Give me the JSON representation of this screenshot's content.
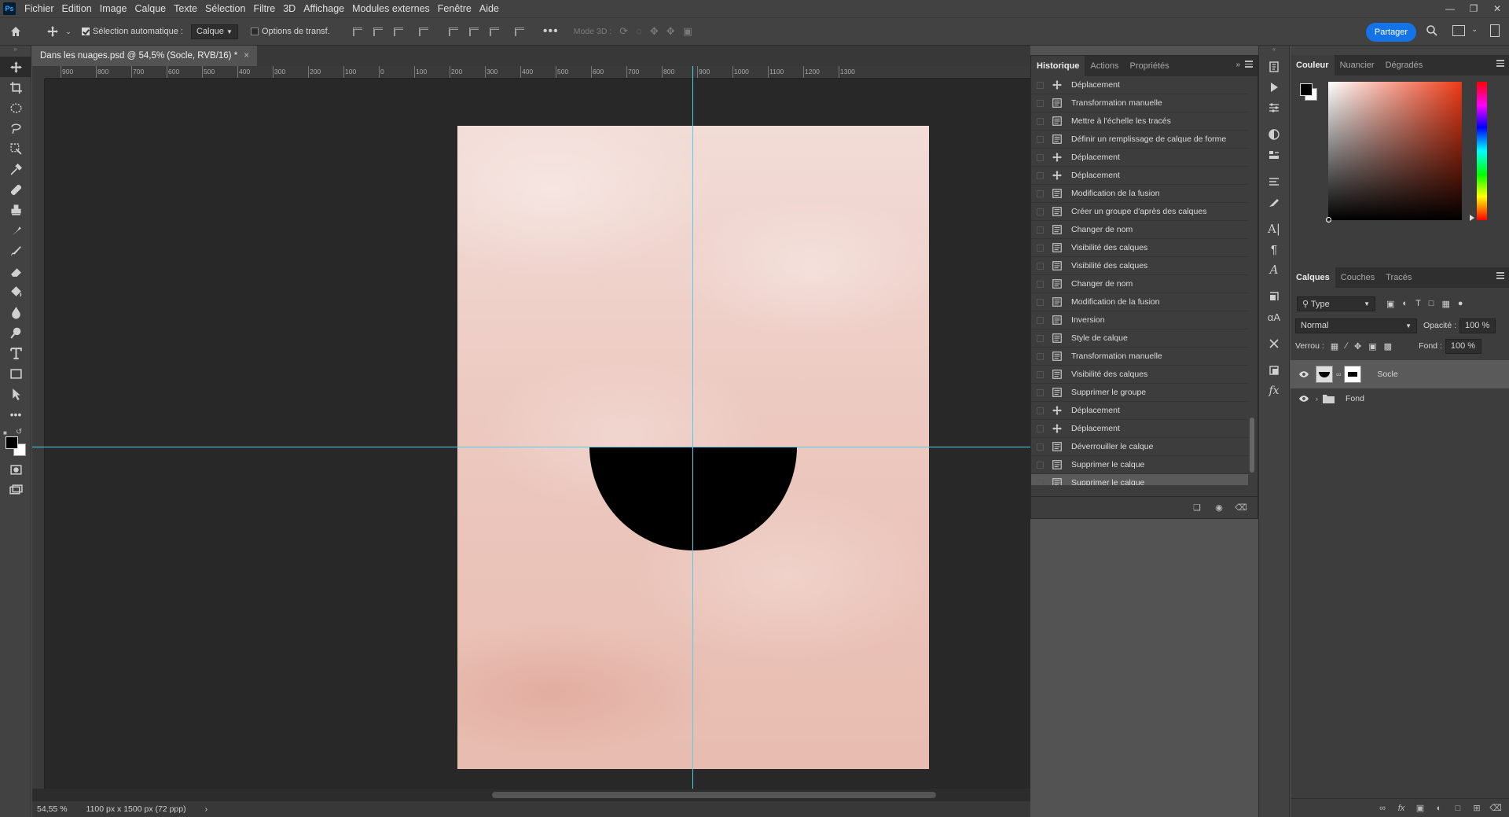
{
  "menubar": {
    "logo": "Ps",
    "items": [
      "Fichier",
      "Edition",
      "Image",
      "Calque",
      "Texte",
      "Sélection",
      "Filtre",
      "3D",
      "Affichage",
      "Modules externes",
      "Fenêtre",
      "Aide"
    ]
  },
  "options": {
    "auto_select_label": "Sélection automatique :",
    "auto_select_value": "Calque",
    "transform_options_label": "Options de transf.",
    "mode3d_label": "Mode 3D :",
    "share_label": "Partager"
  },
  "tab": {
    "title": "Dans les nuages.psd @ 54,5% (Socle, RVB/16) *",
    "close": "×"
  },
  "ruler": {
    "labels": [
      "900",
      "800",
      "700",
      "600",
      "500",
      "400",
      "300",
      "200",
      "100",
      "0",
      "100",
      "200",
      "300",
      "400",
      "500",
      "600",
      "700",
      "800",
      "900",
      "1000",
      "1100",
      "1200",
      "1300"
    ]
  },
  "status": {
    "zoom": "54,55 %",
    "dimensions": "1100 px x 1500 px (72 ppp)"
  },
  "history": {
    "tabs": [
      "Historique",
      "Actions",
      "Propriétés"
    ],
    "items": [
      {
        "label": "Déplacement",
        "icon": "move"
      },
      {
        "label": "Transformation manuelle",
        "icon": "doc"
      },
      {
        "label": "Mettre à l'échelle les tracés",
        "icon": "doc"
      },
      {
        "label": "Définir un remplissage de calque de forme",
        "icon": "doc"
      },
      {
        "label": "Déplacement",
        "icon": "move"
      },
      {
        "label": "Déplacement",
        "icon": "move"
      },
      {
        "label": "Modification de la fusion",
        "icon": "doc"
      },
      {
        "label": "Créer un groupe d'après des calques",
        "icon": "doc"
      },
      {
        "label": "Changer de nom",
        "icon": "doc"
      },
      {
        "label": "Visibilité des calques",
        "icon": "doc"
      },
      {
        "label": "Visibilité des calques",
        "icon": "doc"
      },
      {
        "label": "Changer de nom",
        "icon": "doc"
      },
      {
        "label": "Modification de la fusion",
        "icon": "doc"
      },
      {
        "label": "Inversion",
        "icon": "doc"
      },
      {
        "label": "Style de calque",
        "icon": "doc"
      },
      {
        "label": "Transformation manuelle",
        "icon": "doc"
      },
      {
        "label": "Visibilité des calques",
        "icon": "doc"
      },
      {
        "label": "Supprimer le groupe",
        "icon": "doc"
      },
      {
        "label": "Déplacement",
        "icon": "move"
      },
      {
        "label": "Déplacement",
        "icon": "move"
      },
      {
        "label": "Déverrouiller le calque",
        "icon": "doc"
      },
      {
        "label": "Supprimer le calque",
        "icon": "doc"
      },
      {
        "label": "Supprimer le calque",
        "icon": "doc"
      }
    ],
    "selected_index": 22
  },
  "color_panel": {
    "tabs": [
      "Couleur",
      "Nuancier",
      "Dégradés"
    ],
    "foreground": "#000000",
    "background": "#ffffff"
  },
  "layers_panel": {
    "tabs": [
      "Calques",
      "Couches",
      "Tracés"
    ],
    "filter_label": "Type",
    "blend_mode": "Normal",
    "opacity_label": "Opacité :",
    "opacity_value": "100 %",
    "lock_label": "Verrou :",
    "fill_label": "Fond :",
    "fill_value": "100 %",
    "layers": [
      {
        "name": "Socle",
        "type": "shape",
        "visible": true,
        "selected": true
      },
      {
        "name": "Fond",
        "type": "group",
        "visible": true,
        "selected": false
      }
    ]
  },
  "colors": {
    "guide": "#4fd0e8",
    "accent": "#1473e6"
  }
}
